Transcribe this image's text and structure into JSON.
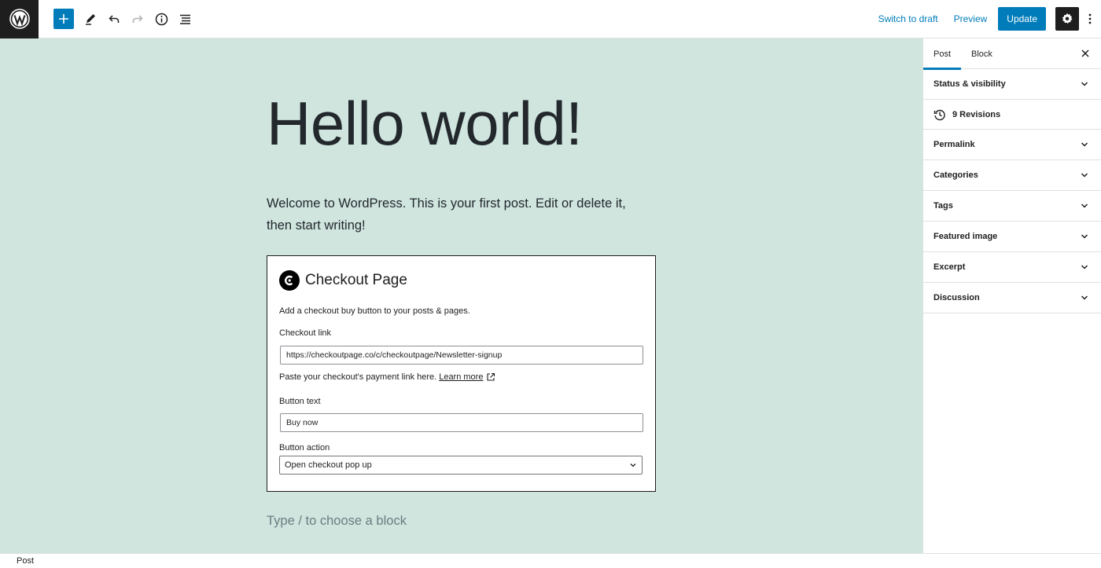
{
  "toolbar": {
    "switch_to_draft": "Switch to draft",
    "preview": "Preview",
    "update": "Update"
  },
  "post": {
    "title": "Hello world!",
    "paragraph": "Welcome to WordPress. This is your first post. Edit or delete it, then start writing!",
    "placeholder": "Type / to choose a block"
  },
  "checkout_block": {
    "title": "Checkout Page",
    "description": "Add a checkout buy button to your posts & pages.",
    "link_label": "Checkout link",
    "link_value": "https://checkoutpage.co/c/checkoutpage/Newsletter-signup",
    "link_help": "Paste your checkout's payment link here.",
    "learn_more": "Learn more",
    "button_text_label": "Button text",
    "button_text_value": "Buy now",
    "button_action_label": "Button action",
    "button_action_value": "Open checkout pop up"
  },
  "sidebar": {
    "tabs": [
      {
        "label": "Post",
        "active": true
      },
      {
        "label": "Block",
        "active": false
      }
    ],
    "panels": [
      {
        "label": "Status & visibility"
      },
      {
        "label": "9 Revisions"
      },
      {
        "label": "Permalink"
      },
      {
        "label": "Categories"
      },
      {
        "label": "Tags"
      },
      {
        "label": "Featured image"
      },
      {
        "label": "Excerpt"
      },
      {
        "label": "Discussion"
      }
    ]
  },
  "footer": {
    "breadcrumb": "Post"
  },
  "colors": {
    "accent": "#007cba",
    "canvas_bg": "#cfe5de",
    "dark": "#1e1e1e"
  }
}
